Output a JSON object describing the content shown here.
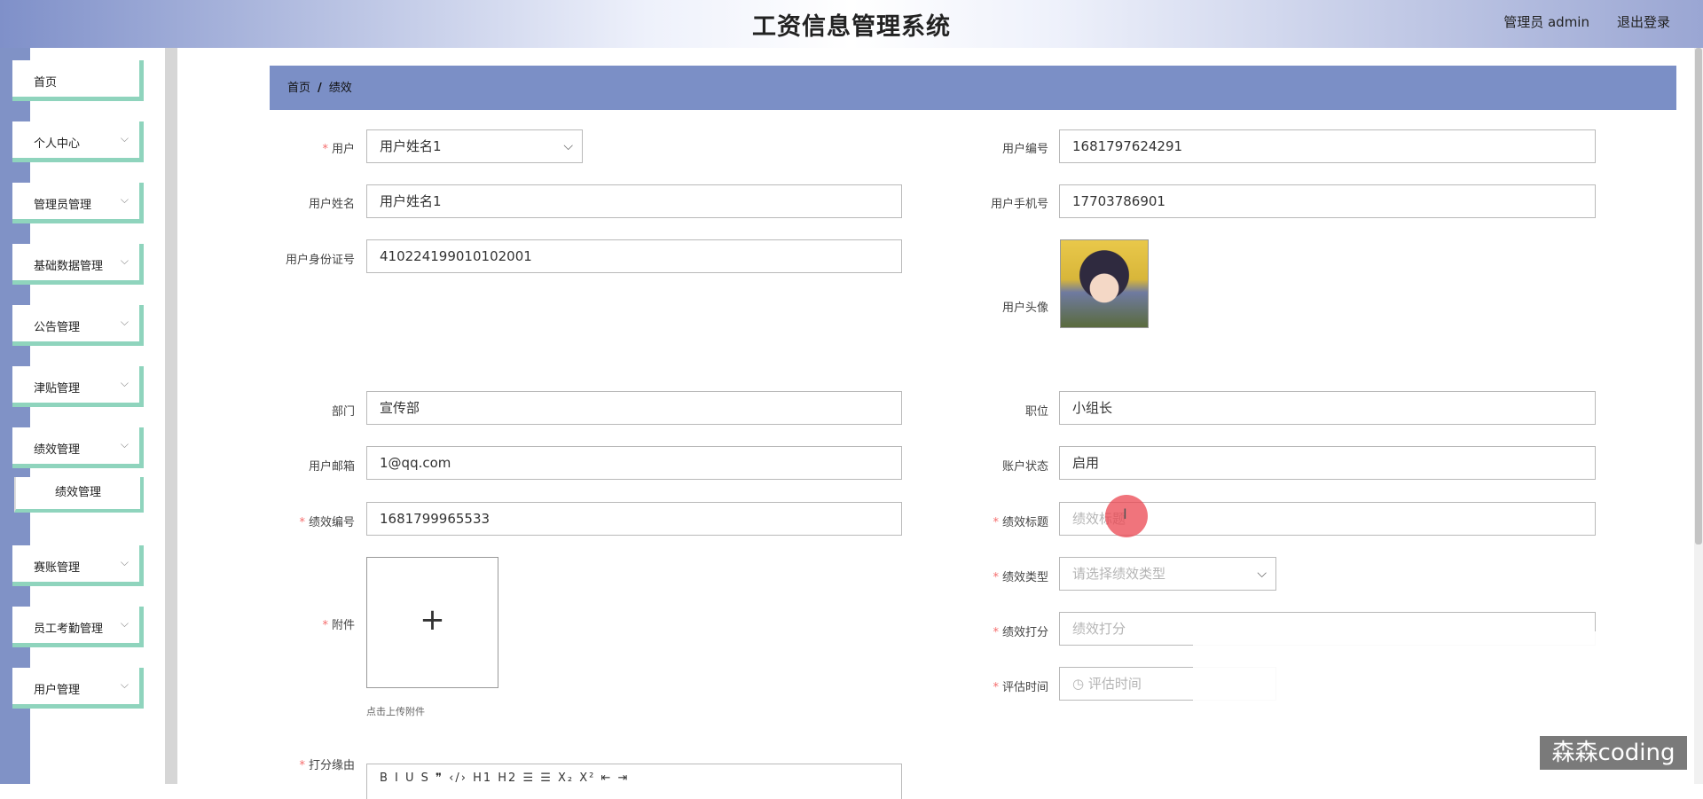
{
  "header": {
    "title": "工资信息管理系统",
    "admin": "管理员 admin",
    "logout": "退出登录"
  },
  "sidebar": {
    "items": [
      {
        "label": "首页"
      },
      {
        "label": "个人中心"
      },
      {
        "label": "管理员管理"
      },
      {
        "label": "基础数据管理"
      },
      {
        "label": "公告管理"
      },
      {
        "label": "津贴管理"
      },
      {
        "label": "绩效管理"
      },
      {
        "label": "赛账管理"
      },
      {
        "label": "员工考勤管理"
      },
      {
        "label": "用户管理"
      }
    ],
    "submenu": {
      "label": "绩效管理"
    },
    "chevron": "⌵"
  },
  "breadcrumb": {
    "home": "首页",
    "separator": "/",
    "current": "绩效"
  },
  "form": {
    "user_label": "用户",
    "user_value": "用户姓名1",
    "user_no_label": "用户编号",
    "user_no_value": "1681797624291",
    "name_label": "用户姓名",
    "name_value": "用户姓名1",
    "phone_label": "用户手机号",
    "phone_value": "17703786901",
    "idcard_label": "用户身份证号",
    "idcard_value": "410224199010102001",
    "avatar_label": "用户头像",
    "dept_label": "部门",
    "dept_value": "宣传部",
    "position_label": "职位",
    "position_value": "小组长",
    "email_label": "用户邮箱",
    "email_value": "1@qq.com",
    "status_label": "账户状态",
    "status_value": "启用",
    "perf_no_label": "绩效编号",
    "perf_no_value": "1681799965533",
    "perf_title_label": "绩效标题",
    "perf_title_placeholder": "绩效标题",
    "perf_type_label": "绩效类型",
    "perf_type_placeholder": "请选择绩效类型",
    "perf_score_label": "绩效打分",
    "perf_score_placeholder": "绩效打分",
    "eval_time_label": "评估时间",
    "eval_time_placeholder": "评估时间",
    "attach_label": "附件",
    "attach_hint": "点击上传附件",
    "reason_label": "打分缘由",
    "editor_toolbar": "B I U S  ❞ ‹/›  H1 H2  ☰ ☰  X₂ X²  ⇤ ⇥",
    "required_mark": "*"
  },
  "watermark": "森森coding"
}
